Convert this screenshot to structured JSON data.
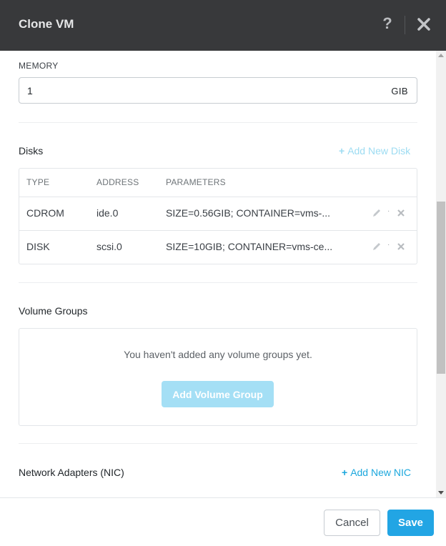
{
  "dialog": {
    "title": "Clone VM",
    "help_icon": "question-icon",
    "close_icon": "close-icon"
  },
  "memory": {
    "label": "MEMORY",
    "value": "1",
    "unit": "GIB"
  },
  "disks": {
    "title": "Disks",
    "add_label": "Add New Disk",
    "columns": [
      "TYPE",
      "ADDRESS",
      "PARAMETERS"
    ],
    "rows": [
      {
        "type": "CDROM",
        "address": "ide.0",
        "parameters": "SIZE=0.56GIB; CONTAINER=vms-..."
      },
      {
        "type": "DISK",
        "address": "scsi.0",
        "parameters": "SIZE=10GIB; CONTAINER=vms-ce..."
      }
    ]
  },
  "volume_groups": {
    "title": "Volume Groups",
    "empty_text": "You haven't added any volume groups yet.",
    "add_button": "Add Volume Group"
  },
  "network": {
    "title": "Network Adapters (NIC)",
    "add_label": "Add New NIC"
  },
  "footer": {
    "cancel_label": "Cancel",
    "save_label": "Save"
  },
  "colors": {
    "header_bg": "#38393b",
    "accent": "#22a5e4",
    "link": "#1ba7dd",
    "link_disabled": "#9ddcf2",
    "button_disabled": "#a4dff5"
  }
}
